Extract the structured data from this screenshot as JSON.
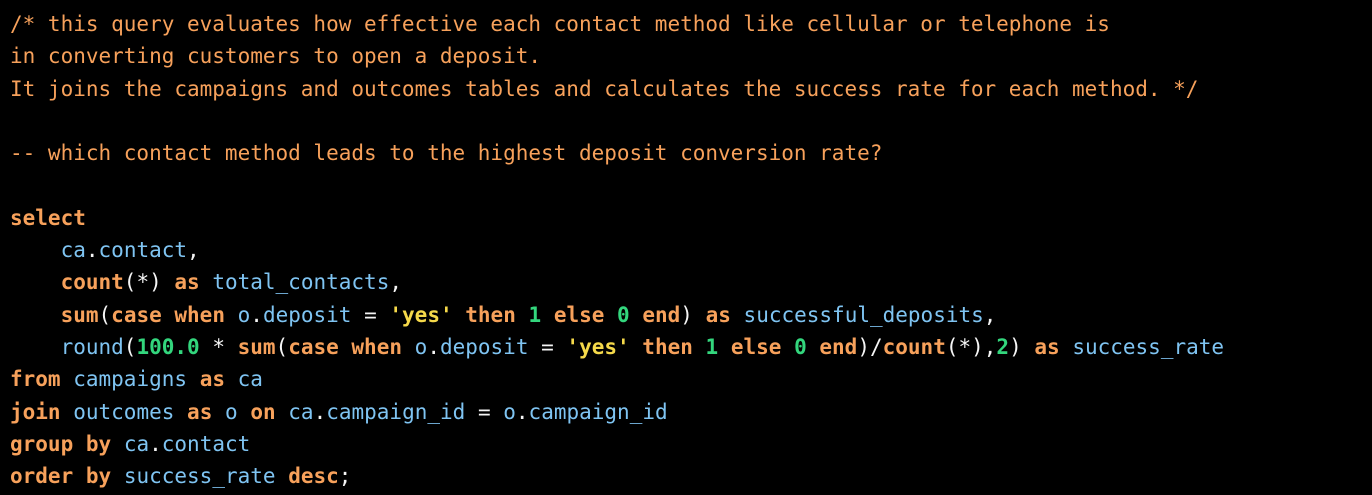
{
  "colors": {
    "background": "#000000",
    "comment": "#f7a15b",
    "keyword": "#f7a15b",
    "identifier": "#7fc4f2",
    "punctuation": "#f5f5f5",
    "string": "#f5d94a",
    "number": "#33d67d"
  },
  "code": {
    "lines": [
      [
        {
          "t": "comment",
          "v": "/* this query evaluates how effective each contact method like cellular or telephone is"
        }
      ],
      [
        {
          "t": "comment",
          "v": "in converting customers to open a deposit."
        }
      ],
      [
        {
          "t": "comment",
          "v": "It joins the campaigns and outcomes tables and calculates the success rate for each method. */"
        }
      ],
      [],
      [
        {
          "t": "comment",
          "v": "-- which contact method leads to the highest deposit conversion rate?"
        }
      ],
      [],
      [
        {
          "t": "kw",
          "v": "select"
        }
      ],
      [
        {
          "t": "punct",
          "v": "    "
        },
        {
          "t": "ident",
          "v": "ca"
        },
        {
          "t": "punct",
          "v": "."
        },
        {
          "t": "ident",
          "v": "contact"
        },
        {
          "t": "punct",
          "v": ","
        }
      ],
      [
        {
          "t": "punct",
          "v": "    "
        },
        {
          "t": "kw",
          "v": "count"
        },
        {
          "t": "punct",
          "v": "(*) "
        },
        {
          "t": "kw",
          "v": "as"
        },
        {
          "t": "punct",
          "v": " "
        },
        {
          "t": "ident",
          "v": "total_contacts"
        },
        {
          "t": "punct",
          "v": ","
        }
      ],
      [
        {
          "t": "punct",
          "v": "    "
        },
        {
          "t": "kw",
          "v": "sum"
        },
        {
          "t": "punct",
          "v": "("
        },
        {
          "t": "kw",
          "v": "case when"
        },
        {
          "t": "punct",
          "v": " "
        },
        {
          "t": "ident",
          "v": "o"
        },
        {
          "t": "punct",
          "v": "."
        },
        {
          "t": "ident",
          "v": "deposit"
        },
        {
          "t": "punct",
          "v": " = "
        },
        {
          "t": "string",
          "v": "'yes'"
        },
        {
          "t": "punct",
          "v": " "
        },
        {
          "t": "kw",
          "v": "then"
        },
        {
          "t": "punct",
          "v": " "
        },
        {
          "t": "number",
          "v": "1"
        },
        {
          "t": "punct",
          "v": " "
        },
        {
          "t": "kw",
          "v": "else"
        },
        {
          "t": "punct",
          "v": " "
        },
        {
          "t": "number",
          "v": "0"
        },
        {
          "t": "punct",
          "v": " "
        },
        {
          "t": "kw",
          "v": "end"
        },
        {
          "t": "punct",
          "v": ") "
        },
        {
          "t": "kw",
          "v": "as"
        },
        {
          "t": "punct",
          "v": " "
        },
        {
          "t": "ident",
          "v": "successful_deposits"
        },
        {
          "t": "punct",
          "v": ","
        }
      ],
      [
        {
          "t": "punct",
          "v": "    "
        },
        {
          "t": "ident",
          "v": "round"
        },
        {
          "t": "punct",
          "v": "("
        },
        {
          "t": "number",
          "v": "100.0"
        },
        {
          "t": "punct",
          "v": " * "
        },
        {
          "t": "kw",
          "v": "sum"
        },
        {
          "t": "punct",
          "v": "("
        },
        {
          "t": "kw",
          "v": "case when"
        },
        {
          "t": "punct",
          "v": " "
        },
        {
          "t": "ident",
          "v": "o"
        },
        {
          "t": "punct",
          "v": "."
        },
        {
          "t": "ident",
          "v": "deposit"
        },
        {
          "t": "punct",
          "v": " = "
        },
        {
          "t": "string",
          "v": "'yes'"
        },
        {
          "t": "punct",
          "v": " "
        },
        {
          "t": "kw",
          "v": "then"
        },
        {
          "t": "punct",
          "v": " "
        },
        {
          "t": "number",
          "v": "1"
        },
        {
          "t": "punct",
          "v": " "
        },
        {
          "t": "kw",
          "v": "else"
        },
        {
          "t": "punct",
          "v": " "
        },
        {
          "t": "number",
          "v": "0"
        },
        {
          "t": "punct",
          "v": " "
        },
        {
          "t": "kw",
          "v": "end"
        },
        {
          "t": "punct",
          "v": ")/"
        },
        {
          "t": "kw",
          "v": "count"
        },
        {
          "t": "punct",
          "v": "(*),"
        },
        {
          "t": "number",
          "v": "2"
        },
        {
          "t": "punct",
          "v": ") "
        },
        {
          "t": "kw",
          "v": "as"
        },
        {
          "t": "punct",
          "v": " "
        },
        {
          "t": "ident",
          "v": "success_rate"
        }
      ],
      [
        {
          "t": "kw",
          "v": "from"
        },
        {
          "t": "punct",
          "v": " "
        },
        {
          "t": "ident",
          "v": "campaigns"
        },
        {
          "t": "punct",
          "v": " "
        },
        {
          "t": "kw",
          "v": "as"
        },
        {
          "t": "punct",
          "v": " "
        },
        {
          "t": "ident",
          "v": "ca"
        }
      ],
      [
        {
          "t": "kw",
          "v": "join"
        },
        {
          "t": "punct",
          "v": " "
        },
        {
          "t": "ident",
          "v": "outcomes"
        },
        {
          "t": "punct",
          "v": " "
        },
        {
          "t": "kw",
          "v": "as"
        },
        {
          "t": "punct",
          "v": " "
        },
        {
          "t": "ident",
          "v": "o"
        },
        {
          "t": "punct",
          "v": " "
        },
        {
          "t": "kw",
          "v": "on"
        },
        {
          "t": "punct",
          "v": " "
        },
        {
          "t": "ident",
          "v": "ca"
        },
        {
          "t": "punct",
          "v": "."
        },
        {
          "t": "ident",
          "v": "campaign_id"
        },
        {
          "t": "punct",
          "v": " = "
        },
        {
          "t": "ident",
          "v": "o"
        },
        {
          "t": "punct",
          "v": "."
        },
        {
          "t": "ident",
          "v": "campaign_id"
        }
      ],
      [
        {
          "t": "kw",
          "v": "group by"
        },
        {
          "t": "punct",
          "v": " "
        },
        {
          "t": "ident",
          "v": "ca"
        },
        {
          "t": "punct",
          "v": "."
        },
        {
          "t": "ident",
          "v": "contact"
        }
      ],
      [
        {
          "t": "kw",
          "v": "order by"
        },
        {
          "t": "punct",
          "v": " "
        },
        {
          "t": "ident",
          "v": "success_rate"
        },
        {
          "t": "punct",
          "v": " "
        },
        {
          "t": "kw",
          "v": "desc"
        },
        {
          "t": "punct",
          "v": ";"
        }
      ]
    ]
  }
}
